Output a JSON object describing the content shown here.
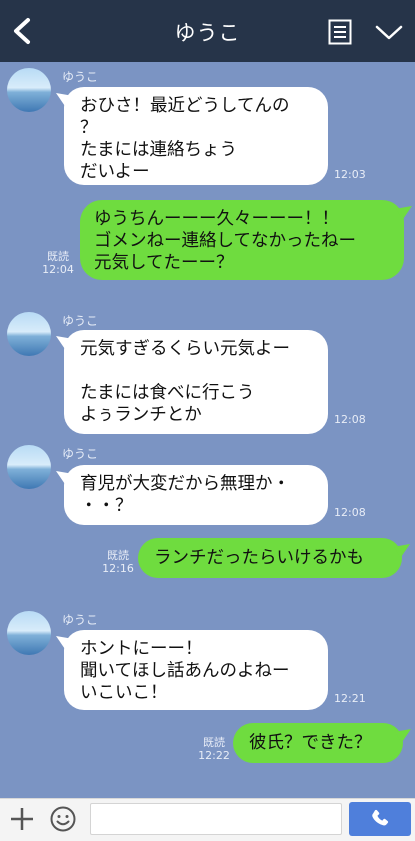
{
  "header": {
    "title": "ゆうこ",
    "back_icon": "chevron-left-icon",
    "menu_icon": "notes-icon",
    "more_icon": "chevron-down-icon",
    "background": "#263449"
  },
  "chat": {
    "background": "#7b94c3",
    "messages": [
      {
        "sender": "ゆうこ",
        "text": "おひさ！最近どうしてんの\n？\nたまには連絡ちょう\nだいよー",
        "time": "12:03"
      },
      {
        "text": "ゆうちんーーー久々ーーー！！\nゴメンねー連絡してなかったねー\n元気してたーー？",
        "read": "既読",
        "time": "12:04"
      },
      {
        "sender": "ゆうこ",
        "text": "元気すぎるくらい元気よー\n\nたまには食べに行こう\nよぅランチとか",
        "time": "12:08"
      },
      {
        "sender": "ゆうこ",
        "text": "育児が大変だから無理か・\n・・？",
        "time": "12:08"
      },
      {
        "text": "ランチだったらいけるかも",
        "read": "既読",
        "time": "12:16"
      },
      {
        "sender": "ゆうこ",
        "text": "ホントにーー！\n聞いてほし話あんのよねー\nいこいこ！",
        "time": "12:21"
      },
      {
        "text": "彼氏？できた？",
        "read": "既読",
        "time": "12:22"
      }
    ]
  },
  "input": {
    "value": "",
    "plus_icon": "plus-icon",
    "emoji_icon": "smiley-icon",
    "call_icon": "phone-icon",
    "accent": "#4f7fdb"
  },
  "colors": {
    "incoming_bubble": "#ffffff",
    "outgoing_bubble": "#6fdc3f"
  }
}
